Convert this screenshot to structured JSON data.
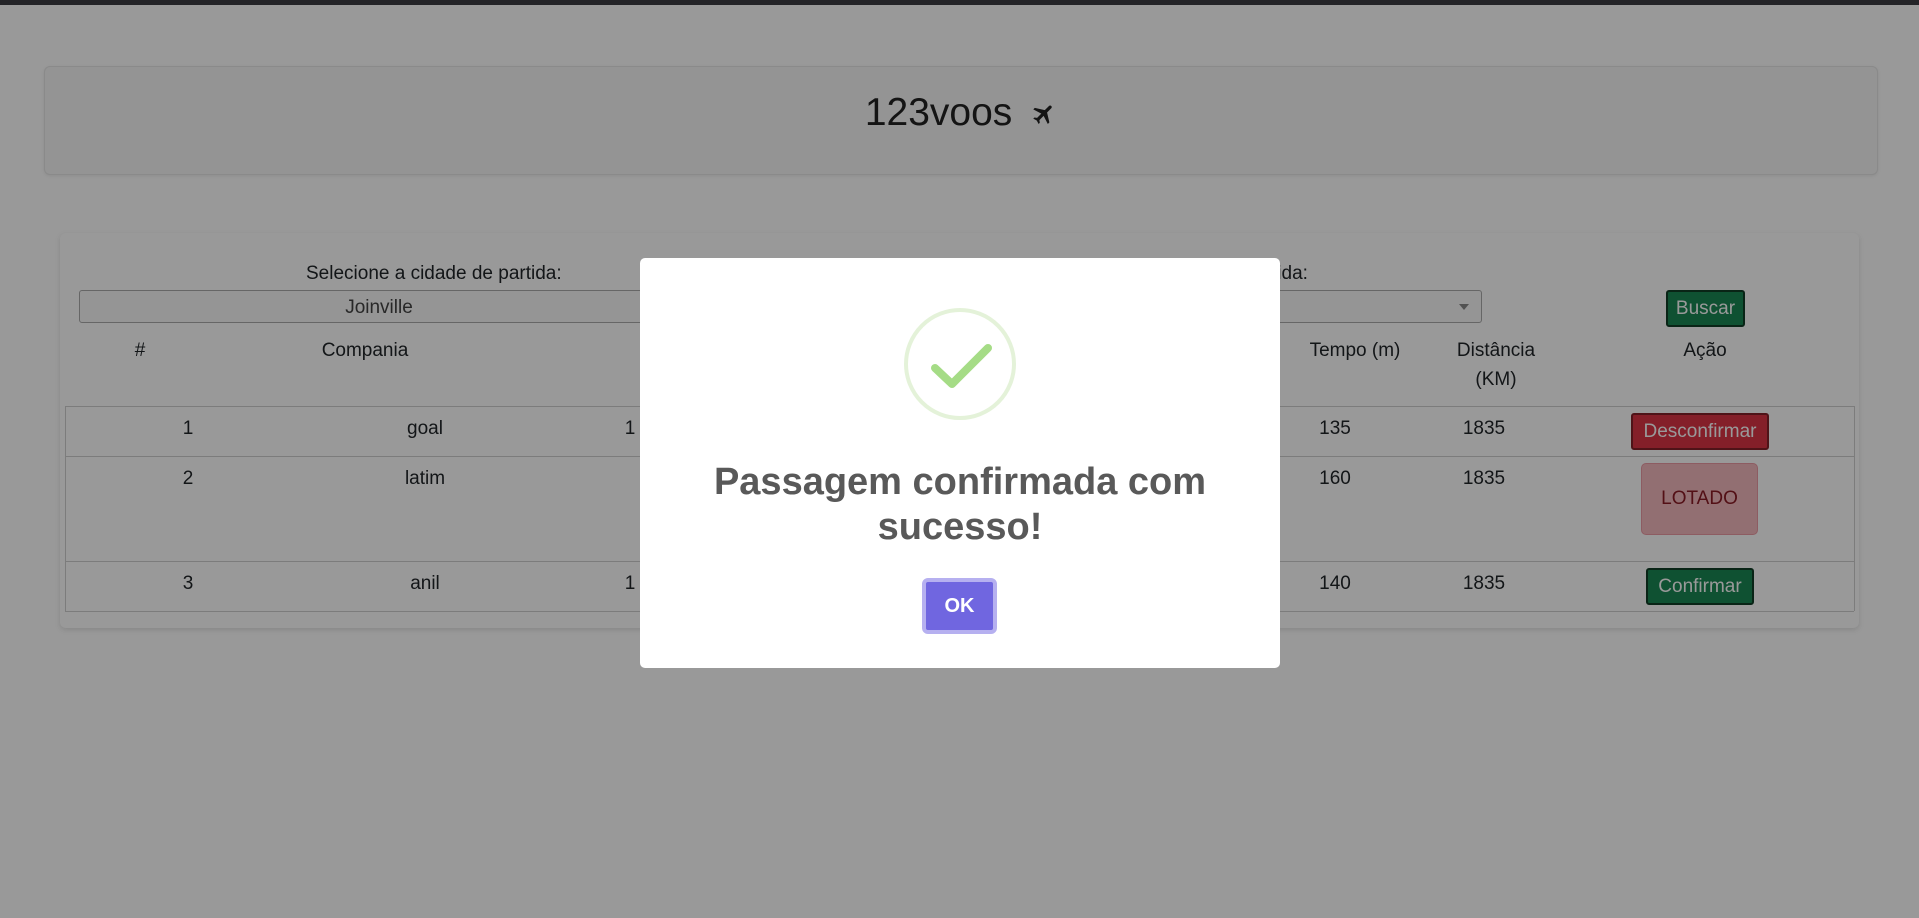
{
  "app": {
    "brand": "123voos"
  },
  "search": {
    "origin_label": "Selecione a cidade de partida:",
    "origin_value": "Joinville",
    "destination_label_partial": "tida:",
    "destination_value": "",
    "search_button": "Buscar"
  },
  "table": {
    "headers": {
      "num": "#",
      "company": "Compania",
      "time": "Tempo (m)",
      "distance_line1": "Distância",
      "distance_line2": "(KM)",
      "action": "Ação"
    },
    "rows": [
      {
        "num": "1",
        "company": "goal",
        "partial": "1",
        "time": "135",
        "distance": "1835",
        "action": "Desconfirmar"
      },
      {
        "num": "2",
        "company": "latim",
        "partial": "",
        "time": "160",
        "distance": "1835",
        "action": "LOTADO"
      },
      {
        "num": "3",
        "company": "anil",
        "partial": "1",
        "time": "140",
        "distance": "1835",
        "action": "Confirmar"
      }
    ]
  },
  "modal": {
    "title": "Passagem confirmada com sucesso!",
    "ok_button": "OK",
    "icon": "success-check-icon"
  },
  "colors": {
    "confirm": "#198754",
    "unconfirm": "#dc3545",
    "sold_out": "#f3b9bf",
    "modal_button": "#7066e0",
    "success_check": "#a5dc86"
  }
}
